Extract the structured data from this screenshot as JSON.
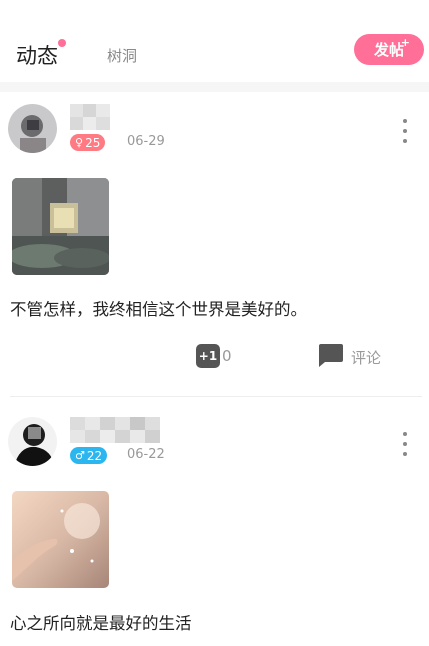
{
  "header": {
    "tab_active": "动态",
    "tab_inactive": "树洞",
    "post_button": "发帖",
    "post_button_plus": "+"
  },
  "posts": [
    {
      "badge": {
        "symbol": "♀",
        "age": "25",
        "color": "#ff7a82"
      },
      "date": "06-29",
      "content": "不管怎样，我终相信这个世界是美好的。",
      "like_label": "+1",
      "like_count": "0",
      "comment_label": "评论"
    },
    {
      "badge": {
        "symbol": "♂",
        "age": "22",
        "color": "#2bb6f0"
      },
      "date": "06-22",
      "content": "心之所向就是最好的生活"
    }
  ],
  "colors": {
    "accent": "#ff6f97",
    "female": "#ff7a82",
    "male": "#2bb6f0"
  }
}
